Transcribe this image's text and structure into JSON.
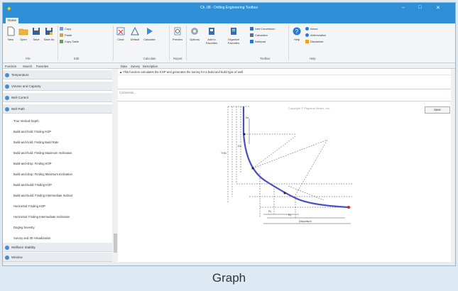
{
  "window": {
    "title": "Ch. 08 - Drilling Engineering Toolbox",
    "controls": [
      "–",
      "□",
      "✕"
    ]
  },
  "ribbon_tab": "Home",
  "ribbon": {
    "file_buttons": [
      "New",
      "Open",
      "Save",
      "Save As"
    ],
    "edit_small": [
      "Copy",
      "Paste",
      "Copy Table"
    ],
    "calc_buttons": [
      "Clear",
      "Default",
      "Calculate"
    ],
    "report_buttons": [
      "Preview"
    ],
    "options_buttons": [
      "Options",
      "Add to Favorites",
      "Organize Favorites"
    ],
    "toolbox_small": [
      "Unit Conversion",
      "Calculator",
      "Notepad"
    ],
    "help_buttons": [
      "Help"
    ],
    "help_small": [
      "About",
      "Abbreviation",
      "Disclaimer"
    ],
    "groups": [
      "File",
      "Edit",
      "Calculate",
      "Report",
      "Toolbox",
      "Help"
    ]
  },
  "function_tabs": [
    "Function",
    "Search",
    "Favorites"
  ],
  "content_tabs": [
    "Data",
    "Survey",
    "Description"
  ],
  "sidebar": {
    "categories_top": [
      "Temperature",
      "Volume and Capacity",
      "Well Control",
      "Well Path"
    ],
    "items": [
      "True Vertical Depth",
      "Build-and-hold: Finding KOP",
      "Build-and-hold: Finding Build Rate",
      "Build-and-hold: Finding Maximum Inclination",
      "Build-and-drop: Finding KOP",
      "Build-and-drop: Finding Maximum Inclination",
      "Build-and-build: Finding KOP",
      "Build-and-build: Finding Intermediate Inclinat",
      "Horizontal: Finding KOP",
      "Horizontal: Finding Intermediate Inclination",
      "Dogleg Severity",
      "Survey and 3D Visualization"
    ],
    "categories_bottom": [
      "Wellbore Stability",
      "Window"
    ]
  },
  "description": "This function calculates the KOP and generates the survey for a build and build type of well.",
  "comments_placeholder": "Comments...",
  "save_label": "Save",
  "copyright": "Copyright © Pegasus Vertex, Inc.",
  "graph_labels": {
    "dr": "Dr",
    "dv": "Dv",
    "tvd": "TVD",
    "departure": "Departure",
    "r1": "R₁",
    "r2": "R₂"
  },
  "caption": "Graph",
  "colors": {
    "titlebar": "#2e8fd6",
    "path": "#4a4fc2",
    "target": "#d42a1a"
  }
}
